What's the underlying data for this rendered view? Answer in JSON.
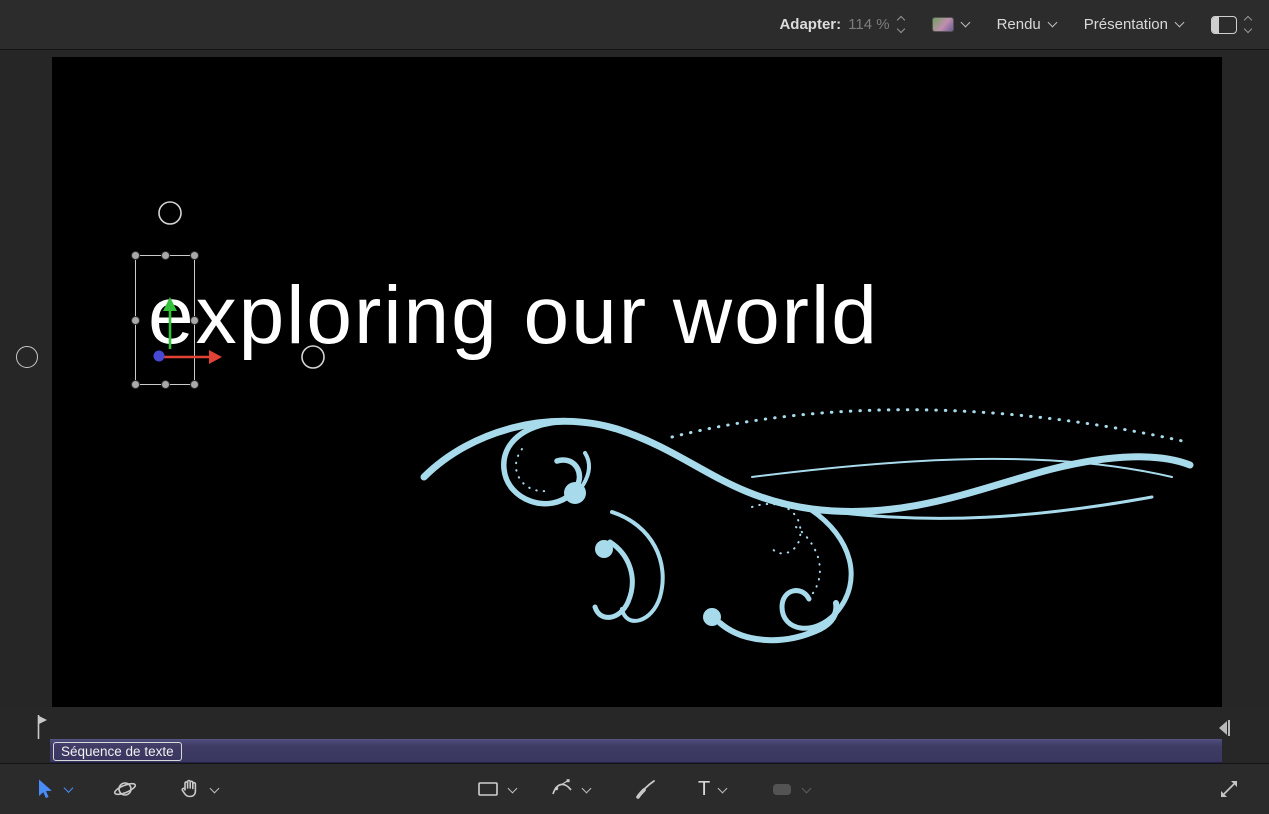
{
  "top_toolbar": {
    "adapter_label": "Adapter:",
    "zoom_value": "114 %",
    "zoom_stepper_icon": "up-down-stepper-icon",
    "color_swatch_icon": "color-thumbnail-icon",
    "render_menu": "Rendu",
    "view_menu": "Présentation",
    "layout_icon": "window-layout-icon"
  },
  "canvas": {
    "text": "exploring our world",
    "background": "#000000",
    "text_color": "#ffffff",
    "flourish_color": "#a7dbec",
    "selection": {
      "handle_count": 8,
      "move_up_arrow_color": "#35c03c",
      "move_right_arrow_color": "#e04334",
      "anchor_dot_color": "#4749d4",
      "guide_circle_color": "#c9c9c9"
    }
  },
  "timeline": {
    "track_label": "Séquence de texte",
    "bar_color": "#403e66",
    "start_marker_icon": "flag-pin-icon",
    "end_marker_icon": "end-bracket-icon"
  },
  "bottom_toolbar": {
    "tools": [
      {
        "name": "select-transform",
        "icon": "arrow-cursor-icon",
        "active": true
      },
      {
        "name": "transform-3d",
        "icon": "orbit-sphere-icon"
      },
      {
        "name": "pan",
        "icon": "hand-icon"
      },
      {
        "name": "rectangle",
        "icon": "rectangle-icon"
      },
      {
        "name": "bezier",
        "icon": "pen-curve-icon"
      },
      {
        "name": "paint-stroke",
        "icon": "brush-icon"
      },
      {
        "name": "text",
        "icon": "letter-t-icon",
        "label": "T"
      },
      {
        "name": "image-mask",
        "icon": "rounded-rect-icon",
        "disabled": true
      }
    ],
    "expand_icon": "expand-diagonal-icon"
  }
}
